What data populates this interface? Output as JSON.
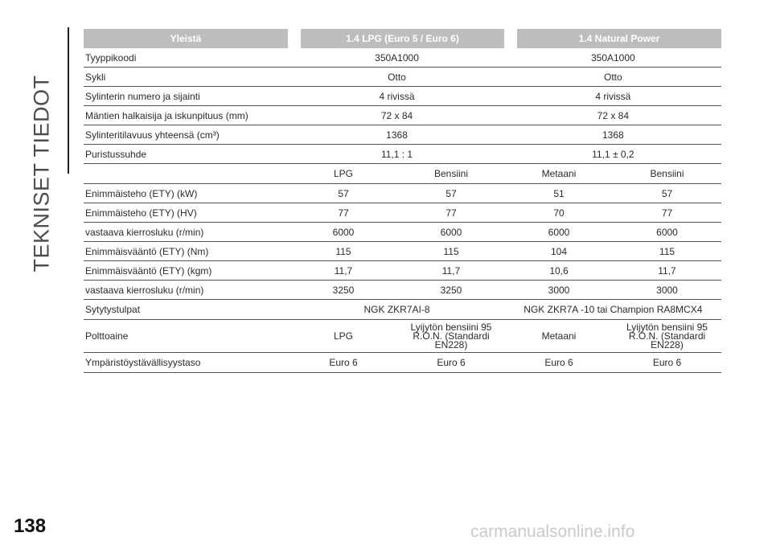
{
  "page": {
    "side_title": "TEKNISET TIEDOT",
    "page_number": "138",
    "watermark": "carmanualsonline.info"
  },
  "table": {
    "headers": [
      "Yleistä",
      "1.4 LPG (Euro 5 / Euro 6)",
      "1.4 Natural Power"
    ],
    "general_rows": [
      {
        "label": "Tyyppikoodi",
        "lpg": "350A1000",
        "np": "350A1000"
      },
      {
        "label": "Sykli",
        "lpg": "Otto",
        "np": "Otto"
      },
      {
        "label": "Sylinterin numero ja sijainti",
        "lpg": "4 rivissä",
        "np": "4 rivissä"
      },
      {
        "label": "Mäntien halkaisija ja iskunpituus (mm)",
        "lpg": "72 x 84",
        "np": "72 x 84"
      },
      {
        "label": "Sylinteritilavuus yhteensä (cm³)",
        "lpg": "1368",
        "np": "1368"
      },
      {
        "label": "Puristussuhde",
        "lpg": "11,1 : 1",
        "np": "11,1 ± 0,2"
      }
    ],
    "fuel_header": [
      "LPG",
      "Bensiini",
      "Metaani",
      "Bensiini"
    ],
    "perf_rows": [
      {
        "label": "Enimmäisteho (ETY) (kW)",
        "values": [
          "57",
          "57",
          "51",
          "57"
        ]
      },
      {
        "label": "Enimmäisteho (ETY) (HV)",
        "values": [
          "77",
          "77",
          "70",
          "77"
        ]
      },
      {
        "label": "vastaava kierrosluku (r/min)",
        "values": [
          "6000",
          "6000",
          "6000",
          "6000"
        ]
      },
      {
        "label": "Enimmäisvääntö (ETY) (Nm)",
        "values": [
          "115",
          "115",
          "104",
          "115"
        ]
      },
      {
        "label": "Enimmäisvääntö (ETY) (kgm)",
        "values": [
          "11,7",
          "11,7",
          "10,6",
          "11,7"
        ]
      },
      {
        "label": "vastaava kierrosluku (r/min)",
        "values": [
          "3250",
          "3250",
          "3000",
          "3000"
        ]
      }
    ],
    "spark": {
      "label": "Sytytystulpat",
      "lpg": "NGK ZKR7AI-8",
      "np": "NGK ZKR7A -10 tai Champion RA8MCX4"
    },
    "fuel_row": {
      "label": "Polttoaine",
      "values": [
        [
          "LPG"
        ],
        [
          "Lyijytön bensiini 95",
          "R.O.N. (Standardi",
          "EN228)"
        ],
        [
          "Metaani"
        ],
        [
          "Lyijytön bensiini 95",
          "R.O.N. (Standardi",
          "EN228)"
        ]
      ]
    },
    "env_row": {
      "label": "Ympäristöystävällisyystaso",
      "values": [
        "Euro 6",
        "Euro 6",
        "Euro 6",
        "Euro 6"
      ]
    }
  }
}
